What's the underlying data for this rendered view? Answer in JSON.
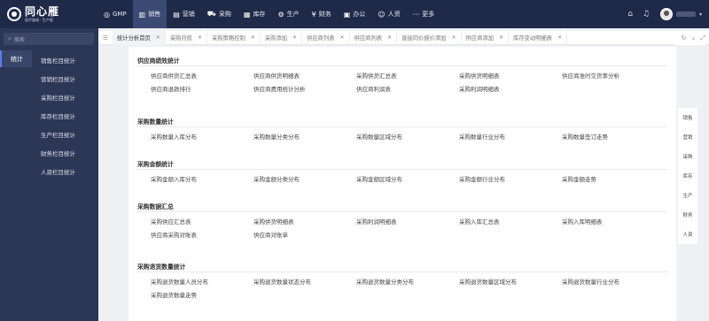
{
  "app": {
    "logo_title": "同心雁",
    "logo_subtitle": "医疗器械 · 生产版"
  },
  "topnav": [
    {
      "label": "GMP",
      "icon": "gmp-icon",
      "glyph": "◎",
      "active": false
    },
    {
      "label": "销售",
      "icon": "sales-icon",
      "glyph": "▥",
      "active": true
    },
    {
      "label": "营销",
      "icon": "marketing-icon",
      "glyph": "▤",
      "active": false
    },
    {
      "label": "采购",
      "icon": "cart-icon",
      "glyph": "⛟",
      "active": false
    },
    {
      "label": "库存",
      "icon": "warehouse-icon",
      "glyph": "▦",
      "active": false
    },
    {
      "label": "生产",
      "icon": "production-icon",
      "glyph": "⚙",
      "active": false
    },
    {
      "label": "财务",
      "icon": "finance-icon",
      "glyph": "¥",
      "active": false
    },
    {
      "label": "办公",
      "icon": "office-icon",
      "glyph": "▣",
      "active": false
    },
    {
      "label": "人资",
      "icon": "hr-icon",
      "glyph": "☺",
      "active": false
    },
    {
      "label": "更多",
      "icon": "more-icon",
      "glyph": "···",
      "active": false
    }
  ],
  "sidebar": {
    "search_placeholder": "搜索",
    "primary": "统计",
    "items": [
      "销售栏目统计",
      "营销栏目统计",
      "采购栏目统计",
      "库存栏目统计",
      "生产栏目统计",
      "财务栏目统计",
      "人资栏目统计"
    ]
  },
  "tabs": [
    {
      "label": "统计分析首页",
      "active": true
    },
    {
      "label": "采购问航",
      "active": false
    },
    {
      "label": "采购策略控制",
      "active": false
    },
    {
      "label": "采购添加",
      "active": false
    },
    {
      "label": "供应商列表",
      "active": false
    },
    {
      "label": "供应商列表",
      "active": false
    },
    {
      "label": "直接同价报价添加",
      "active": false
    },
    {
      "label": "供应商添加",
      "active": false
    },
    {
      "label": "库存变动明细表",
      "active": false
    }
  ],
  "sections": [
    {
      "title": "供应商绩效统计",
      "links": [
        "供应商供货汇总表",
        "供应商供货明细表",
        "采购供货汇总表",
        "采购供货明细表",
        "供应商准时交货率分析",
        "供应商退款排行",
        "供应商费用统计分析",
        "供应商利润表",
        "采购利润明细表"
      ]
    },
    {
      "title": "采购数量统计",
      "links": [
        "采购数量入库分布",
        "采购数量分类分布",
        "采购数量区域分布",
        "采购数量行业分布",
        "采购数量签订走势"
      ]
    },
    {
      "title": "采购金额统计",
      "links": [
        "采购金额入库分布",
        "采购金额分类分布",
        "采购金额区域分布",
        "采购金额行业分布",
        "采购金额走势"
      ]
    },
    {
      "title": "采购数据汇总",
      "links": [
        "采购供应汇总表",
        "采购供货明细表",
        "采购利润明细表",
        "采购入库汇总表",
        "采购入库明细表",
        "供应商采购对账表",
        "供应商对账单"
      ]
    },
    {
      "title": "采购退货数量统计",
      "links": [
        "采购退货数量人员分布",
        "采购退货数量状态分布",
        "采购退货数量分类分布",
        "采购退货数量区域分布",
        "采购退货数量行业分布",
        "采购退货数量走势"
      ]
    }
  ],
  "rail": [
    "销售",
    "营销",
    "采购",
    "库存",
    "生产",
    "财务",
    "人资"
  ]
}
